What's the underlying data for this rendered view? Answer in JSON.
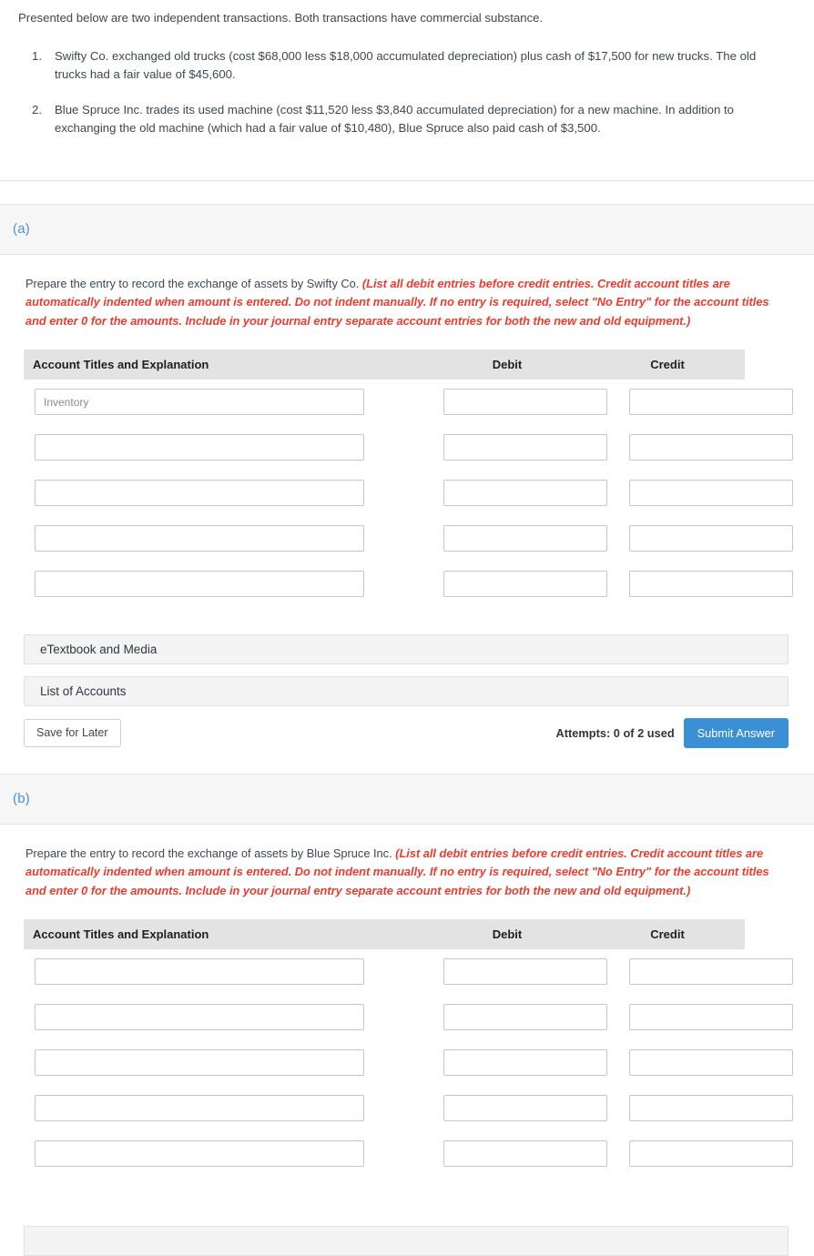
{
  "intro": {
    "lead": "Presented below are two independent transactions. Both transactions have commercial substance.",
    "transactions": [
      {
        "number": "1.",
        "text": "Swifty Co. exchanged old trucks (cost $68,000 less $18,000 accumulated depreciation) plus cash of $17,500 for new trucks. The old trucks had a fair value of $45,600."
      },
      {
        "number": "2.",
        "text": "Blue Spruce Inc. trades its used machine (cost $11,520 less $3,840 accumulated depreciation) for a new machine. In addition to exchanging the old machine (which had a fair value of $10,480), Blue Spruce also paid cash of $3,500."
      }
    ]
  },
  "colors": {
    "part_label": "#4a90d9",
    "hint_red": "#ef3b2d",
    "submit_blue": "#3b8fd4",
    "band_gray": "#f6f6f6",
    "table_header_gray": "#e3e3e3"
  },
  "table_headers": {
    "account": "Account Titles and Explanation",
    "debit": "Debit",
    "credit": "Credit"
  },
  "part_a": {
    "label": "(a)",
    "prompt_lead": "Prepare the entry to record the exchange of assets by Swifty Co.",
    "prompt_hint": "(List all debit entries before credit entries. Credit account titles are automatically indented when amount is entered. Do not indent manually. If no entry is required, select \"No Entry\" for the account titles and enter 0 for the amounts. Include in your journal entry separate account entries for both the new and old equipment.)",
    "rows": [
      {
        "account": "",
        "account_placeholder": "Inventory",
        "debit": "",
        "credit": ""
      },
      {
        "account": "",
        "account_placeholder": "",
        "debit": "",
        "credit": ""
      },
      {
        "account": "",
        "account_placeholder": "",
        "debit": "",
        "credit": ""
      },
      {
        "account": "",
        "account_placeholder": "",
        "debit": "",
        "credit": ""
      },
      {
        "account": "",
        "account_placeholder": "",
        "debit": "",
        "credit": ""
      }
    ],
    "etextbook_label": "eTextbook and Media",
    "list_of_accounts_label": "List of Accounts",
    "save_label": "Save for Later",
    "attempts_label": "Attempts: 0 of 2 used",
    "submit_label": "Submit Answer"
  },
  "part_b": {
    "label": "(b)",
    "prompt_lead": "Prepare the entry to record the exchange of assets by Blue Spruce Inc.",
    "prompt_hint": "(List all debit entries before credit entries. Credit account titles are automatically indented when amount is entered. Do not indent manually. If no entry is required, select \"No Entry\" for the account titles and enter 0 for the amounts. Include in your journal entry separate account entries for both the new and old equipment.)",
    "rows": [
      {
        "account": "",
        "account_placeholder": "",
        "debit": "",
        "credit": ""
      },
      {
        "account": "",
        "account_placeholder": "",
        "debit": "",
        "credit": ""
      },
      {
        "account": "",
        "account_placeholder": "",
        "debit": "",
        "credit": ""
      },
      {
        "account": "",
        "account_placeholder": "",
        "debit": "",
        "credit": ""
      },
      {
        "account": "",
        "account_placeholder": "",
        "debit": "",
        "credit": ""
      }
    ],
    "etextbook_label": ""
  }
}
